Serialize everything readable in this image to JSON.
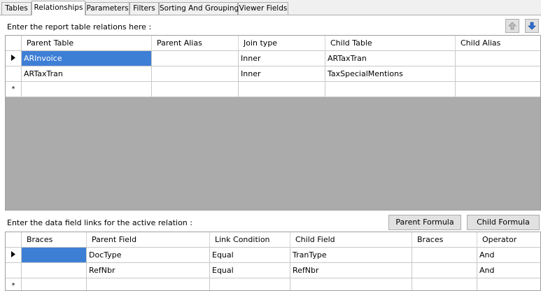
{
  "tabs": [
    {
      "label": "Tables",
      "active": false
    },
    {
      "label": "Relationships",
      "active": true
    },
    {
      "label": "Parameters",
      "active": false
    },
    {
      "label": "Filters",
      "active": false
    },
    {
      "label": "Sorting And Grouping",
      "active": false
    },
    {
      "label": "Viewer Fields",
      "active": false
    }
  ],
  "relations": {
    "caption": "Enter the report table relations here :",
    "move_up_icon": "arrow-up-icon",
    "move_down_icon": "arrow-down-icon",
    "columns": [
      "Parent Table",
      "Parent Alias",
      "Join type",
      "Child Table",
      "Child Alias"
    ],
    "rows": [
      {
        "current": true,
        "cells": [
          "ARInvoice",
          "",
          "Inner",
          "ARTaxTran",
          ""
        ]
      },
      {
        "current": false,
        "cells": [
          "ARTaxTran",
          "",
          "Inner",
          "TaxSpecialMentions",
          ""
        ]
      }
    ],
    "new_row_marker": "*"
  },
  "links": {
    "caption": "Enter the data field links for the active relation :",
    "parent_formula_label": "Parent Formula",
    "child_formula_label": "Child Formula",
    "columns": [
      "Braces",
      "Parent Field",
      "Link Condition",
      "Child Field",
      "Braces",
      "Operator"
    ],
    "rows": [
      {
        "current": true,
        "cells": [
          "",
          "DocType",
          "Equal",
          "TranType",
          "",
          "And"
        ]
      },
      {
        "current": false,
        "cells": [
          "",
          "RefNbr",
          "Equal",
          "RefNbr",
          "",
          "And"
        ]
      }
    ],
    "new_row_marker": "*"
  }
}
